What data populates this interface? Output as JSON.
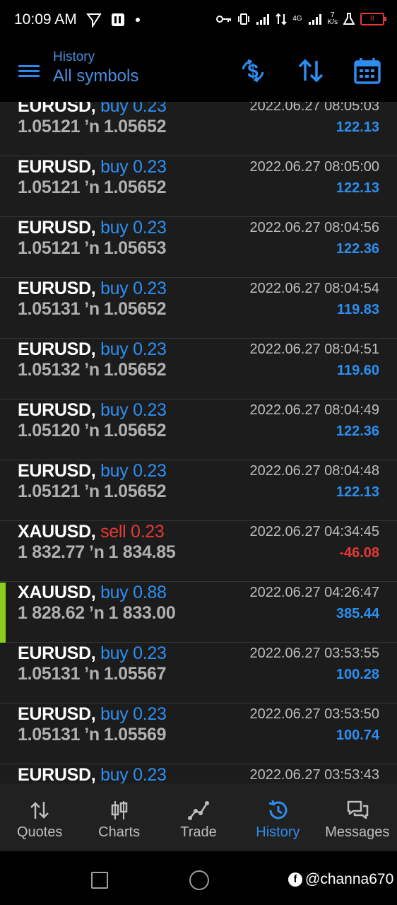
{
  "status_bar": {
    "time": "10:09 AM",
    "network_type": "4G",
    "speed_value": "7",
    "speed_unit": "K/s",
    "battery_level": "8"
  },
  "toolbar": {
    "subtitle": "History",
    "title": "All symbols",
    "icons": [
      "menu-icon",
      "currency-exchange-icon",
      "sort-icon",
      "calendar-icon"
    ]
  },
  "colors": {
    "accent": "#2d8ef0",
    "sell": "#e53935",
    "marker": "#8ccc1a",
    "background": "#1c1c1c"
  },
  "deals": [
    {
      "symbol": "EURUSD,",
      "side": "buy",
      "volume": "0.23",
      "open_price": "1.05121",
      "close_price": "1.05652",
      "time": "2022.06.27 08:05:03",
      "profit": "122.13"
    },
    {
      "symbol": "EURUSD,",
      "side": "buy",
      "volume": "0.23",
      "open_price": "1.05121",
      "close_price": "1.05652",
      "time": "2022.06.27 08:05:00",
      "profit": "122.13"
    },
    {
      "symbol": "EURUSD,",
      "side": "buy",
      "volume": "0.23",
      "open_price": "1.05121",
      "close_price": "1.05653",
      "time": "2022.06.27 08:04:56",
      "profit": "122.36"
    },
    {
      "symbol": "EURUSD,",
      "side": "buy",
      "volume": "0.23",
      "open_price": "1.05131",
      "close_price": "1.05652",
      "time": "2022.06.27 08:04:54",
      "profit": "119.83"
    },
    {
      "symbol": "EURUSD,",
      "side": "buy",
      "volume": "0.23",
      "open_price": "1.05132",
      "close_price": "1.05652",
      "time": "2022.06.27 08:04:51",
      "profit": "119.60"
    },
    {
      "symbol": "EURUSD,",
      "side": "buy",
      "volume": "0.23",
      "open_price": "1.05120",
      "close_price": "1.05652",
      "time": "2022.06.27 08:04:49",
      "profit": "122.36"
    },
    {
      "symbol": "EURUSD,",
      "side": "buy",
      "volume": "0.23",
      "open_price": "1.05121",
      "close_price": "1.05652",
      "time": "2022.06.27 08:04:48",
      "profit": "122.13"
    },
    {
      "symbol": "XAUUSD,",
      "side": "sell",
      "volume": "0.23",
      "open_price": "1 832.77",
      "close_price": "1 834.85",
      "time": "2022.06.27 04:34:45",
      "profit": "-46.08"
    },
    {
      "symbol": "XAUUSD,",
      "side": "buy",
      "volume": "0.88",
      "open_price": "1 828.62",
      "close_price": "1 833.00",
      "time": "2022.06.27 04:26:47",
      "profit": "385.44",
      "marked": true
    },
    {
      "symbol": "EURUSD,",
      "side": "buy",
      "volume": "0.23",
      "open_price": "1.05131",
      "close_price": "1.05567",
      "time": "2022.06.27 03:53:55",
      "profit": "100.28"
    },
    {
      "symbol": "EURUSD,",
      "side": "buy",
      "volume": "0.23",
      "open_price": "1.05131",
      "close_price": "1.05569",
      "time": "2022.06.27 03:53:50",
      "profit": "100.74"
    },
    {
      "symbol": "EURUSD,",
      "side": "buy",
      "volume": "0.23",
      "open_price": "",
      "close_price": "",
      "time": "2022.06.27 03:53:43",
      "profit": ""
    }
  ],
  "bottom_nav": [
    {
      "label": "Quotes",
      "icon": "quotes-icon"
    },
    {
      "label": "Charts",
      "icon": "charts-icon"
    },
    {
      "label": "Trade",
      "icon": "trade-icon"
    },
    {
      "label": "History",
      "icon": "history-icon",
      "active": true
    },
    {
      "label": "Messages",
      "icon": "messages-icon"
    }
  ],
  "watermark": "@channa670"
}
